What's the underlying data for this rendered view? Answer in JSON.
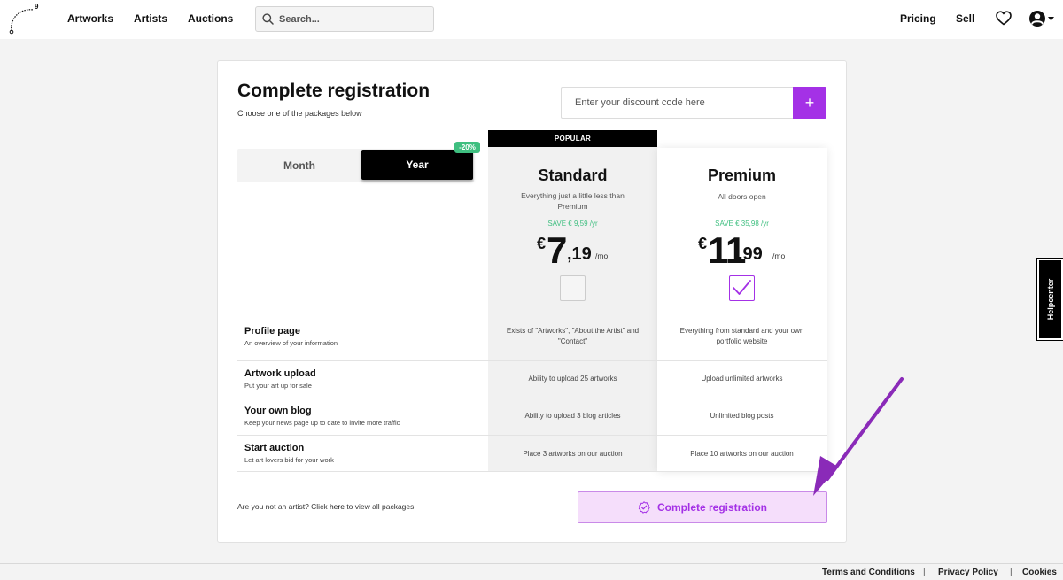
{
  "nav": {
    "logo_mark": "9",
    "links": [
      "Artworks",
      "Artists",
      "Auctions"
    ],
    "search_placeholder": "Search...",
    "right_links": [
      "Pricing",
      "Sell"
    ]
  },
  "card": {
    "title": "Complete registration",
    "subtitle": "Choose one of the packages below",
    "discount_placeholder": "Enter your discount code here",
    "discount_add": "+",
    "toggle": {
      "month": "Month",
      "year": "Year",
      "year_badge": "-20%",
      "selected": "Year"
    }
  },
  "plans": {
    "standard": {
      "badge": "POPULAR",
      "name": "Standard",
      "description": "Everything just a little less than Premium",
      "save": "SAVE € 9,59 /yr",
      "currency": "€",
      "price_whole": "7",
      "price_cents": ",19",
      "per": "/mo",
      "selected": false
    },
    "premium": {
      "name": "Premium",
      "description": "All doors open",
      "save": "SAVE € 35,98 /yr",
      "currency": "€",
      "price_whole": "11",
      "price_cents": ",99",
      "per": "/mo",
      "selected": true
    }
  },
  "features": [
    {
      "title": "Profile page",
      "subtitle": "An overview of your information",
      "standard": "Exists of \"Artworks\", \"About the Artist\" and \"Contact\"",
      "premium": "Everything from standard and your own portfolio website"
    },
    {
      "title": "Artwork upload",
      "subtitle": "Put your art up for sale",
      "standard": "Ability to upload 25 artworks",
      "premium": "Upload unlimited artworks"
    },
    {
      "title": "Your own blog",
      "subtitle": "Keep your news page up to date to invite more traffic",
      "standard": "Ability to upload 3 blog articles",
      "premium": "Unlimited blog posts"
    },
    {
      "title": "Start auction",
      "subtitle": "Let art lovers bid for your work",
      "standard": "Place 3 artworks on our auction",
      "premium": "Place 10 artworks on our auction"
    }
  ],
  "bottom": {
    "note_before": "Are you not an artist? Click ",
    "note_link": "here",
    "note_after": " to view all packages.",
    "complete_button": "Complete registration"
  },
  "helpcenter": "Helpcenter",
  "footer": {
    "links": [
      "Terms and Conditions",
      "Privacy Policy",
      "Cookies"
    ],
    "separator": "|"
  },
  "colors": {
    "accent": "#a431e6",
    "save_green": "#3fbf80",
    "annotation_arrow": "#8a2ab8"
  }
}
